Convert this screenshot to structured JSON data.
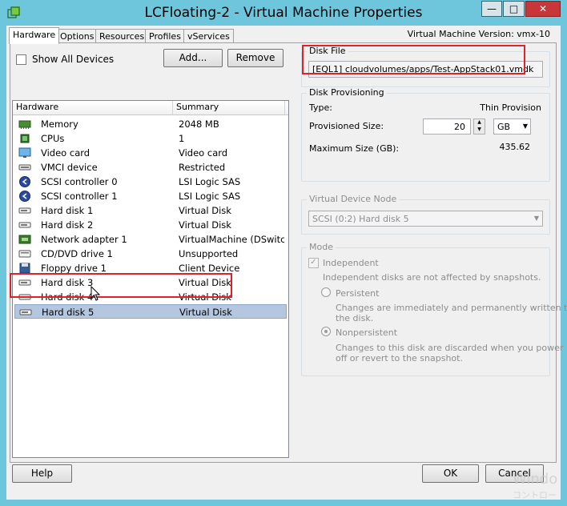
{
  "window": {
    "title": "LCFloating-2 - Virtual Machine Properties",
    "vm_version": "Virtual Machine Version: vmx-10"
  },
  "tabs": [
    {
      "label": "Hardware",
      "active": true
    },
    {
      "label": "Options",
      "active": false
    },
    {
      "label": "Resources",
      "active": false
    },
    {
      "label": "Profiles",
      "active": false
    },
    {
      "label": "vServices",
      "active": false
    }
  ],
  "toolbar": {
    "show_all_devices_label": "Show All Devices",
    "show_all_devices_checked": false,
    "add_label": "Add...",
    "remove_label": "Remove"
  },
  "device_list": {
    "col_hardware": "Hardware",
    "col_summary": "Summary",
    "rows": [
      {
        "icon": "memory-icon",
        "name": "Memory",
        "summary": "2048 MB"
      },
      {
        "icon": "cpu-icon",
        "name": "CPUs",
        "summary": "1"
      },
      {
        "icon": "video-card-icon",
        "name": "Video card",
        "summary": "Video card"
      },
      {
        "icon": "vmci-device-icon",
        "name": "VMCI device",
        "summary": "Restricted"
      },
      {
        "icon": "scsi-controller-icon",
        "name": "SCSI controller 0",
        "summary": "LSI Logic SAS"
      },
      {
        "icon": "scsi-controller-icon",
        "name": "SCSI controller 1",
        "summary": "LSI Logic SAS"
      },
      {
        "icon": "hard-disk-icon",
        "name": "Hard disk 1",
        "summary": "Virtual Disk"
      },
      {
        "icon": "hard-disk-icon",
        "name": "Hard disk 2",
        "summary": "Virtual Disk"
      },
      {
        "icon": "network-adapter-icon",
        "name": "Network adapter 1",
        "summary": "VirtualMachine (DSwitc..."
      },
      {
        "icon": "cd-dvd-icon",
        "name": "CD/DVD drive 1",
        "summary": "Unsupported"
      },
      {
        "icon": "floppy-icon",
        "name": "Floppy drive 1",
        "summary": "Client Device"
      },
      {
        "icon": "hard-disk-icon",
        "name": "Hard disk 3",
        "summary": "Virtual Disk"
      },
      {
        "icon": "hard-disk-icon",
        "name": "Hard disk 4",
        "summary": "Virtual Disk"
      },
      {
        "icon": "hard-disk-icon",
        "name": "Hard disk 5",
        "summary": "Virtual Disk",
        "selected": true
      }
    ]
  },
  "disk_file": {
    "label": "Disk File",
    "value": "[EQL1] cloudvolumes/apps/Test-AppStack01.vmdk"
  },
  "disk_provisioning": {
    "label": "Disk Provisioning",
    "type_label": "Type:",
    "type_value": "Thin Provision",
    "provisioned_size_label": "Provisioned Size:",
    "provisioned_size_value": "20",
    "unit_value": "GB",
    "max_size_label": "Maximum Size (GB):",
    "max_size_value": "435.62"
  },
  "virtual_device_node": {
    "label": "Virtual Device Node",
    "value": "SCSI (0:2) Hard disk 5"
  },
  "mode": {
    "label": "Mode",
    "independent_label": "Independent",
    "independent_checked": true,
    "independent_desc": "Independent disks are not affected by snapshots.",
    "persistent_label": "Persistent",
    "persistent_desc_1": "Changes are immediately and permanently written to",
    "persistent_desc_2": "the disk.",
    "nonpersistent_label": "Nonpersistent",
    "nonpersistent_desc_1": "Changes to this disk are discarded when you power",
    "nonpersistent_desc_2": "off or revert to the snapshot.",
    "selected": "Nonpersistent"
  },
  "footer": {
    "help_label": "Help",
    "ok_label": "OK",
    "cancel_label": "Cancel"
  },
  "watermark": {
    "line1": "Windo",
    "line2": "コントロー"
  }
}
